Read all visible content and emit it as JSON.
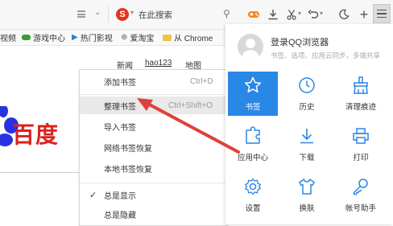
{
  "toolbar": {
    "search_engine": "S",
    "search_placeholder": "在此搜索"
  },
  "bookmarks_bar": {
    "items": [
      "视频",
      "游戏中心",
      "热门影视",
      "爱淘宝",
      "从 Chrome"
    ]
  },
  "page": {
    "nav_links": [
      "新闻",
      "hao123",
      "地图"
    ],
    "logo_text": "百度"
  },
  "context_menu": {
    "items": [
      {
        "label": "添加书签",
        "shortcut": "Ctrl+D"
      },
      {
        "label": "整理书签",
        "shortcut": "Ctrl+Shift+O"
      },
      {
        "label": "导入书签",
        "shortcut": ""
      },
      {
        "label": "网络书签恢复",
        "shortcut": ""
      },
      {
        "label": "本地书签恢复",
        "shortcut": ""
      },
      {
        "label": "总是显示",
        "shortcut": "",
        "checked": true
      },
      {
        "label": "总是隐藏",
        "shortcut": ""
      }
    ]
  },
  "panel": {
    "login_title": "登录QQ浏览器",
    "login_subtitle": "书签、选项、应用云同步，多端共享",
    "tiles": [
      {
        "label": "书签",
        "icon": "star-icon",
        "active": true
      },
      {
        "label": "历史",
        "icon": "clock-icon"
      },
      {
        "label": "清理痕迹",
        "icon": "broom-icon"
      },
      {
        "label": "应用中心",
        "icon": "puzzle-icon"
      },
      {
        "label": "下载",
        "icon": "download-icon"
      },
      {
        "label": "打印",
        "icon": "printer-icon"
      },
      {
        "label": "设置",
        "icon": "gear-icon"
      },
      {
        "label": "换肤",
        "icon": "shirt-icon"
      },
      {
        "label": "帐号助手",
        "icon": "key-icon"
      }
    ]
  },
  "colors": {
    "accent": "#2987e6",
    "arrow": "#e0403a",
    "baidu_red": "#d9231d",
    "baidu_blue": "#2932e1"
  }
}
